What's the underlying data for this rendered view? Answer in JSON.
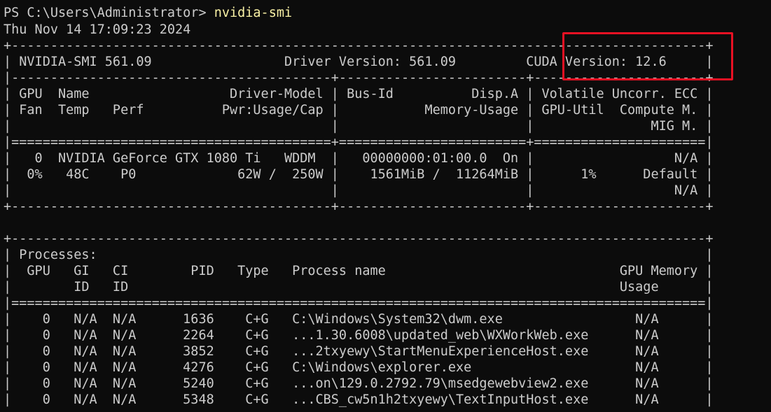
{
  "prompt": {
    "path": "PS C:\\Users\\Administrator> ",
    "command": "nvidia-smi"
  },
  "timestamp": "Thu Nov 14 17:09:23 2024",
  "colors": {
    "background": "#0c0c0c",
    "text": "#cccccc",
    "command": "#f9f1a5",
    "highlight_box": "#e81123"
  },
  "gpu_table": {
    "border_top": "+-----------------------------------------------------------------------------------------+",
    "header_line": "| NVIDIA-SMI 561.09                 Driver Version: 561.09         CUDA Version: 12.6     |",
    "separator_1": "|-----------------------------------------+------------------------+----------------------+",
    "columns_line_1": "| GPU  Name                  Driver-Model | Bus-Id          Disp.A | Volatile Uncorr. ECC |",
    "columns_line_2": "| Fan  Temp   Perf          Pwr:Usage/Cap |           Memory-Usage | GPU-Util  Compute M. |",
    "columns_line_3": "|                                         |                        |               MIG M. |",
    "double_separator": "|=========================================+========================+======================|",
    "gpu_row_1": "|   0  NVIDIA GeForce GTX 1080 Ti   WDDM  |   00000000:01:00.0  On |                  N/A |",
    "gpu_row_2": "|  0%   48C    P0             62W /  250W |    1561MiB /  11264MiB |      1%      Default |",
    "gpu_row_3": "|                                         |                        |                  N/A |",
    "border_bottom": "+-----------------------------------------+------------------------+----------------------+"
  },
  "process_table": {
    "border_top": "+-----------------------------------------------------------------------------------------+",
    "title_line": "| Processes:                                                                              |",
    "columns_line_1": "|  GPU   GI   CI        PID   Type   Process name                              GPU Memory |",
    "columns_line_2": "|        ID   ID                                                               Usage      |",
    "double_separator": "|=========================================================================================|",
    "rows": [
      "|    0   N/A  N/A      1636    C+G   C:\\Windows\\System32\\dwm.exe                 N/A      |",
      "|    0   N/A  N/A      2264    C+G   ...1.30.6008\\updated_web\\WXWorkWeb.exe      N/A      |",
      "|    0   N/A  N/A      3852    C+G   ...2txyewy\\StartMenuExperienceHost.exe      N/A      |",
      "|    0   N/A  N/A      4276    C+G   C:\\Windows\\explorer.exe                     N/A      |",
      "|    0   N/A  N/A      5240    C+G   ...on\\129.0.2792.79\\msedgewebview2.exe      N/A      |",
      "|    0   N/A  N/A      5348    C+G   ...CBS_cw5n1h2txyewy\\TextInputHost.exe      N/A      |"
    ]
  }
}
